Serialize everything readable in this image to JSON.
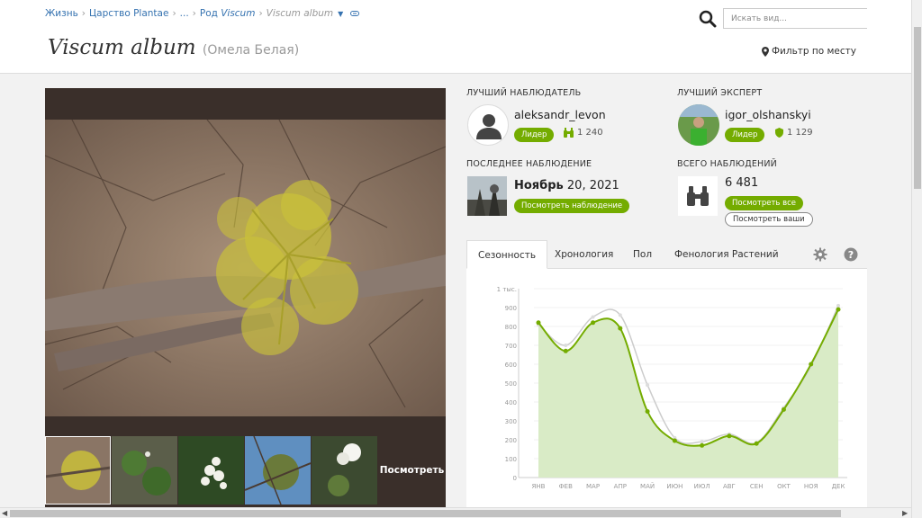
{
  "breadcrumb": {
    "items": [
      "Жизнь",
      "Царство Plantae",
      "...",
      "Род",
      "Viscum",
      "Viscum album"
    ]
  },
  "search": {
    "placeholder": "Искать вид..."
  },
  "title": {
    "scientific": "Viscum album",
    "common": "(Омела Белая)"
  },
  "place_filter": "Фильтр по месту",
  "photos": {
    "view_more": "Посмотреть"
  },
  "top_observer": {
    "label": "ЛУЧШИЙ НАБЛЮДАТЕЛЬ",
    "username": "aleksandr_levon",
    "badge": "Лидер",
    "count": "1 240"
  },
  "top_identifier": {
    "label": "ЛУЧШИЙ ЭКСПЕРТ",
    "username": "igor_olshanskyi",
    "badge": "Лидер",
    "count": "1 129"
  },
  "last_observation": {
    "label": "ПОСЛЕДНЕЕ НАБЛЮДЕНИЕ",
    "month": "Ноябрь",
    "date_rest": " 20, 2021",
    "button": "Посмотреть наблюдение"
  },
  "total_observations": {
    "label": "ВСЕГО НАБЛЮДЕНИЙ",
    "value": "6 481",
    "view_all": "Посмотреть все",
    "view_yours": "Посмотреть ваши"
  },
  "tabs": [
    "Сезонность",
    "Хронология",
    "Пол",
    "Фенология Растений"
  ],
  "colors": {
    "accent": "#74ac00",
    "link": "#3572b0",
    "area": "#d9ebc6",
    "line": "#74ac00",
    "secondary_line": "#cccccc"
  },
  "icons": {
    "search": "search-icon",
    "map_marker": "map-marker-icon",
    "binoculars": "binoculars-icon",
    "shield": "shield-icon",
    "gear": "gear-icon",
    "help": "help-icon",
    "user": "user-icon"
  },
  "chart_data": {
    "type": "line",
    "categories": [
      "ЯНВ",
      "ФЕВ",
      "МАР",
      "АПР",
      "МАЙ",
      "ИЮН",
      "ИЮЛ",
      "АВГ",
      "СЕН",
      "ОКТ",
      "НОЯ",
      "ДЕК"
    ],
    "y_ticks": [
      "0",
      "100",
      "200",
      "300",
      "400",
      "500",
      "600",
      "700",
      "800",
      "900",
      "1 тыс."
    ],
    "ylim": [
      0,
      1000
    ],
    "series": [
      {
        "values": [
          820,
          670,
          820,
          790,
          350,
          195,
          170,
          220,
          180,
          360,
          600,
          890
        ]
      },
      {
        "values": [
          810,
          700,
          850,
          860,
          490,
          210,
          190,
          230,
          185,
          370,
          590,
          910
        ]
      }
    ],
    "grid": true
  }
}
